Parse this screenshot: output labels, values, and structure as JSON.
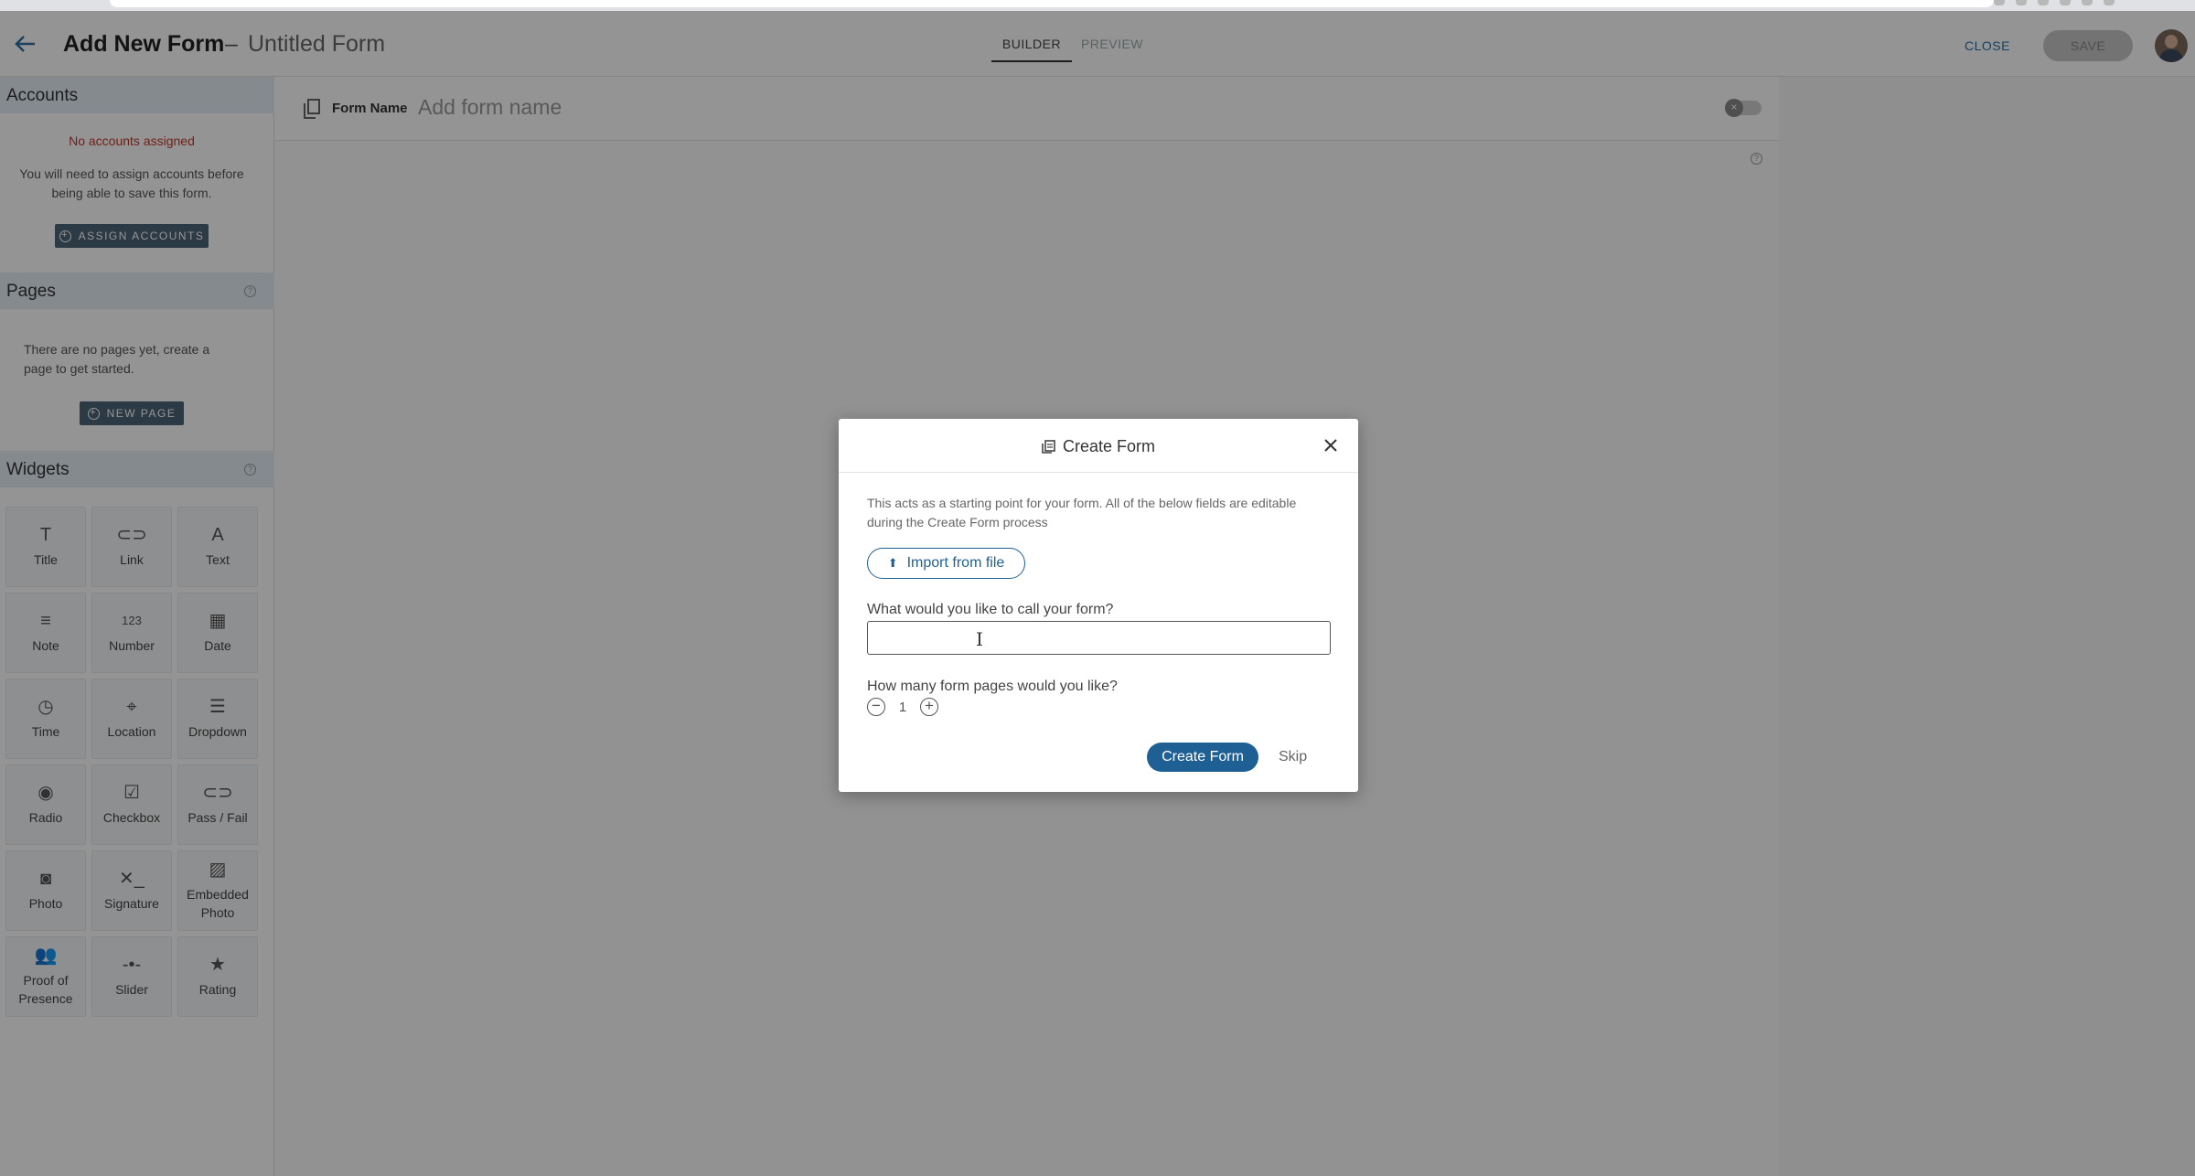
{
  "header": {
    "title": "Add New Form",
    "separator": "–",
    "subtitle": "Untitled Form",
    "tabs": [
      {
        "label": "BUILDER",
        "active": true
      },
      {
        "label": "PREVIEW",
        "active": false
      }
    ],
    "close_label": "CLOSE",
    "save_label": "SAVE"
  },
  "sidebar": {
    "accounts": {
      "heading": "Accounts",
      "warning": "No accounts assigned",
      "info": "You will need to assign accounts before being able to save this form.",
      "button": "ASSIGN ACCOUNTS"
    },
    "pages": {
      "heading": "Pages",
      "empty": "There are no pages yet, create a page to get started.",
      "button": "NEW PAGE"
    },
    "widgets": {
      "heading": "Widgets",
      "items": [
        {
          "label": "Title",
          "icon": "title-icon",
          "glyph": "T"
        },
        {
          "label": "Link",
          "icon": "link-icon",
          "glyph": "⊂⊃"
        },
        {
          "label": "Text",
          "icon": "text-icon",
          "glyph": "A"
        },
        {
          "label": "Note",
          "icon": "note-icon",
          "glyph": "≡"
        },
        {
          "label": "Number",
          "icon": "number-icon",
          "glyph": "123"
        },
        {
          "label": "Date",
          "icon": "calendar-icon",
          "glyph": "▦"
        },
        {
          "label": "Time",
          "icon": "clock-icon",
          "glyph": "◷"
        },
        {
          "label": "Location",
          "icon": "location-icon",
          "glyph": "⌖"
        },
        {
          "label": "Dropdown",
          "icon": "dropdown-icon",
          "glyph": "☰"
        },
        {
          "label": "Radio",
          "icon": "radio-icon",
          "glyph": "◉"
        },
        {
          "label": "Checkbox",
          "icon": "checkbox-icon",
          "glyph": "☑"
        },
        {
          "label": "Pass / Fail",
          "icon": "toggle-icon",
          "glyph": "⊂⊃"
        },
        {
          "label": "Photo",
          "icon": "camera-icon",
          "glyph": "◙"
        },
        {
          "label": "Signature",
          "icon": "signature-icon",
          "glyph": "✕_"
        },
        {
          "label": "Embedded Photo",
          "icon": "image-icon",
          "glyph": "▨"
        },
        {
          "label": "Proof of Presence",
          "icon": "people-icon",
          "glyph": "👥"
        },
        {
          "label": "Slider",
          "icon": "slider-icon",
          "glyph": "-•-"
        },
        {
          "label": "Rating",
          "icon": "star-icon",
          "glyph": "★"
        }
      ]
    }
  },
  "form_name": {
    "label": "Form Name",
    "placeholder": "Add form name"
  },
  "modal": {
    "title": "Create Form",
    "description": "This acts as a starting point for your form. All of the below fields are editable during the Create Form process",
    "import_label": "Import from file",
    "name_question": "What would you like to call your form?",
    "name_value": "",
    "pages_question": "How many form pages would you like?",
    "pages_count": "1",
    "create_label": "Create Form",
    "skip_label": "Skip"
  },
  "colors": {
    "primary": "#1e5f94",
    "sidebar_button": "#4d6478",
    "warning": "#c0392b",
    "section_header": "#e6eef6"
  }
}
